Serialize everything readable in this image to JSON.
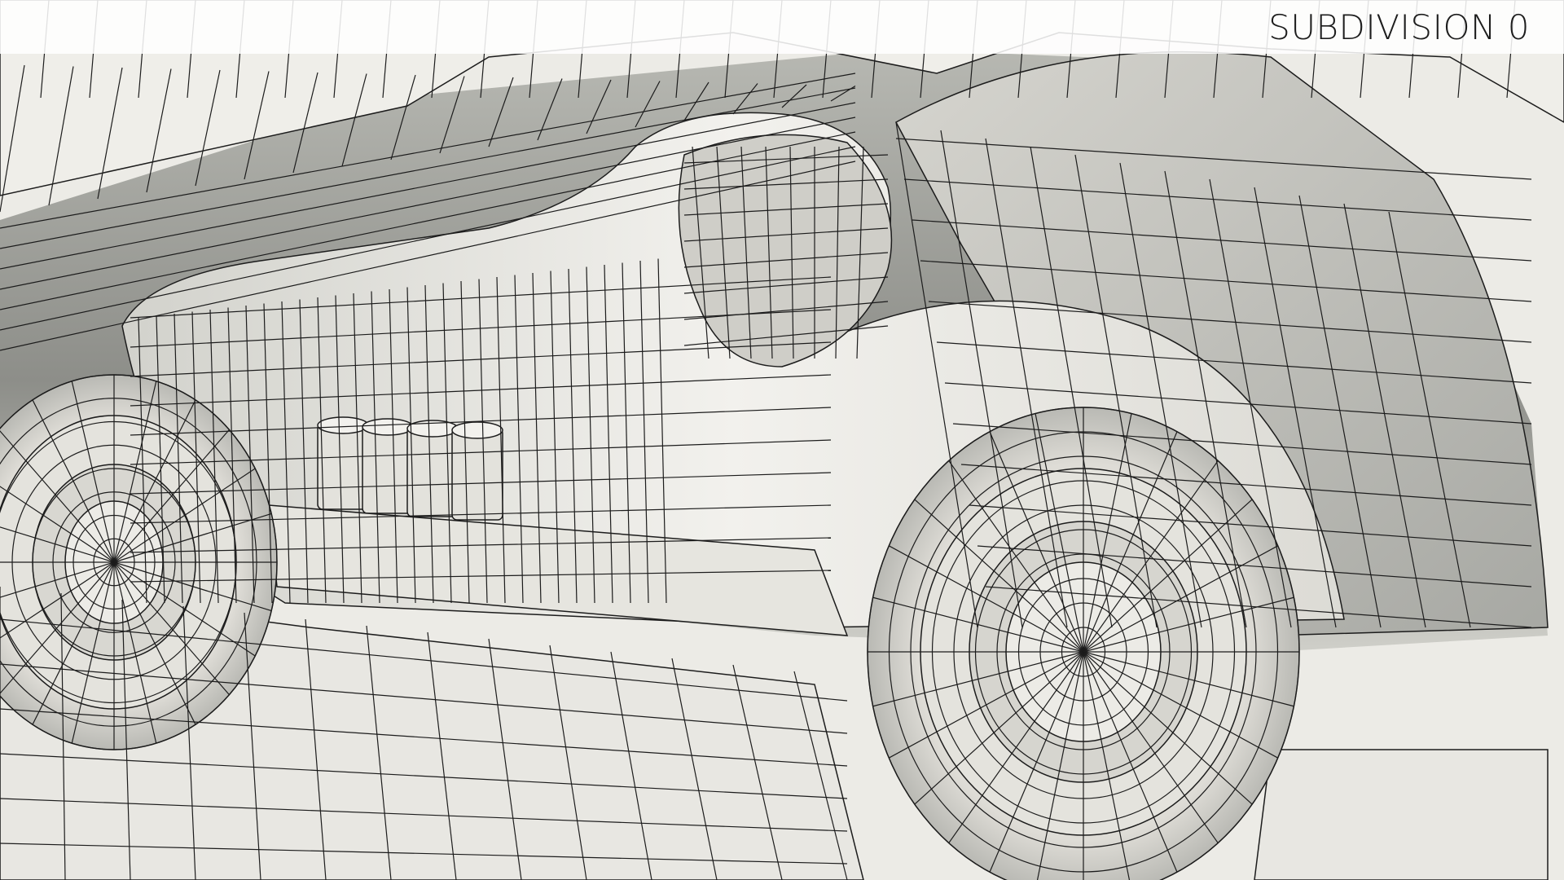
{
  "viewport": {
    "label": "SUBDIVISION 0",
    "colors": {
      "background": "#ecebe6",
      "surface_light": "#f1f0ec",
      "surface_mid": "#d9d8d2",
      "surface_dark": "#8f908b",
      "wire": "#1c1c1c",
      "title_band": "#ffffff",
      "title_text": "#1d1d1d"
    }
  }
}
